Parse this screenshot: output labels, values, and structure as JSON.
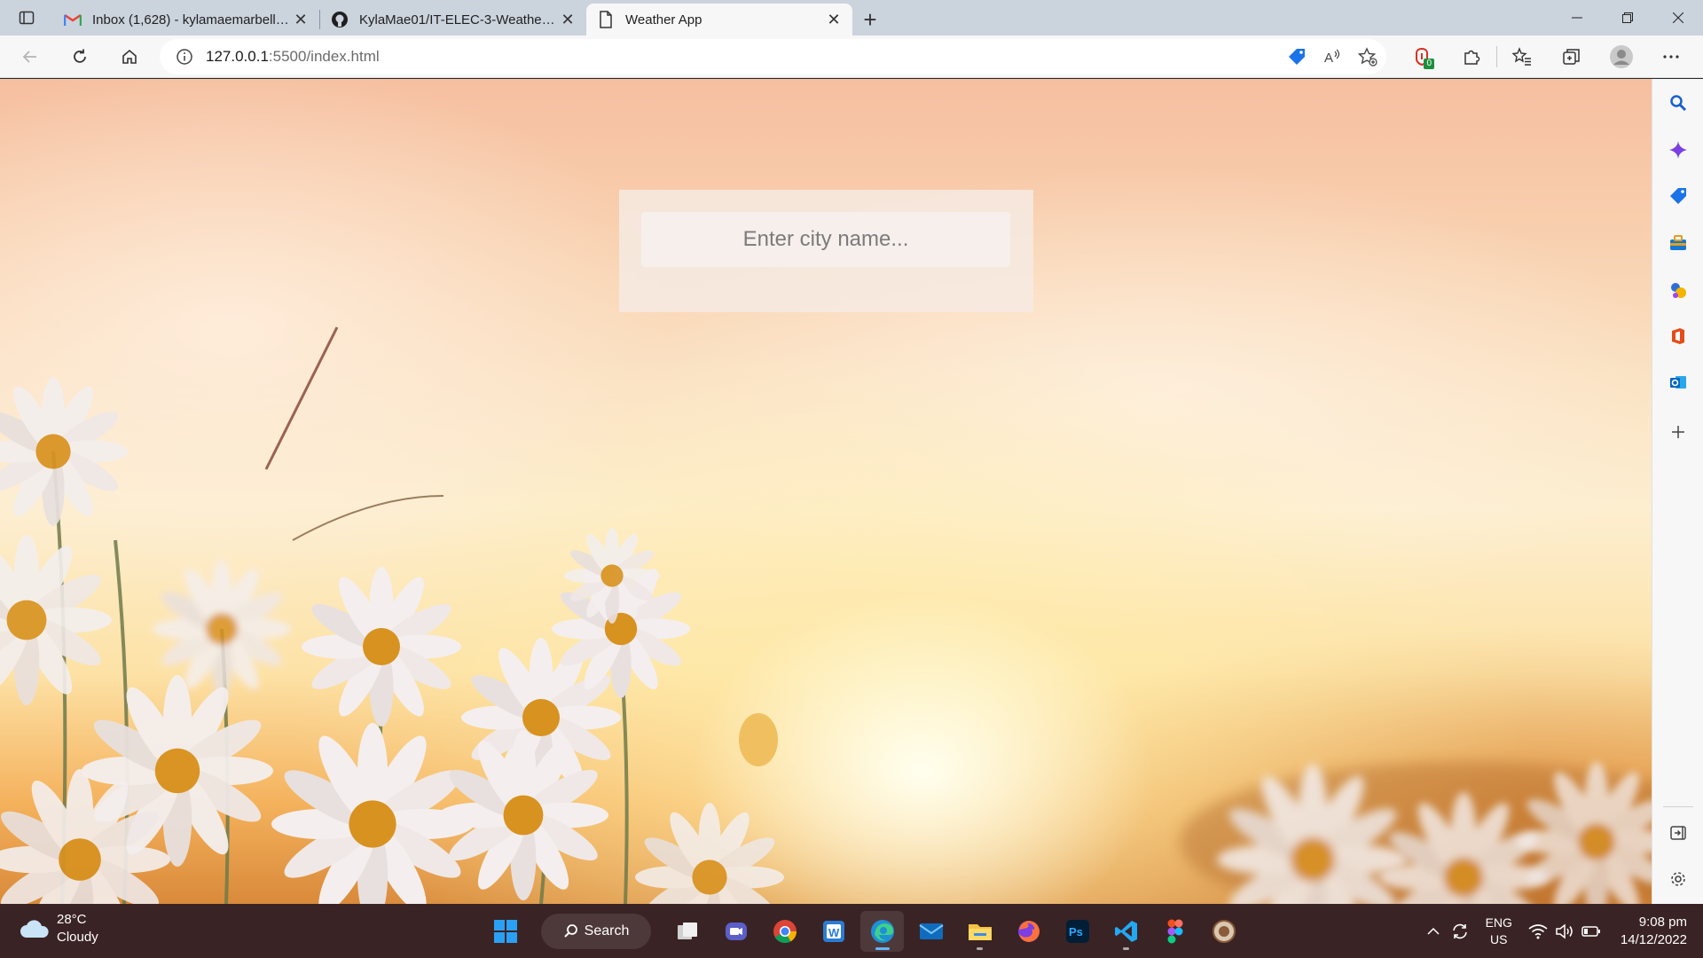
{
  "browser": {
    "tabs": [
      {
        "title": "Inbox (1,628) - kylamaemarbella@",
        "icon": "gmail-icon"
      },
      {
        "title": "KylaMae01/IT-ELEC-3-Weather-A",
        "icon": "github-icon"
      },
      {
        "title": "Weather App",
        "icon": "page-icon",
        "active": true
      }
    ],
    "address": {
      "host": "127.0.0.1",
      "path": ":5500/index.html"
    },
    "extension_badge": "0"
  },
  "page": {
    "search": {
      "placeholder": "Enter city name...",
      "value": ""
    }
  },
  "taskbar": {
    "weather": {
      "temp": "28°C",
      "condition": "Cloudy"
    },
    "search_label": "Search",
    "language": {
      "line1": "ENG",
      "line2": "US"
    },
    "clock": {
      "time": "9:08 pm",
      "date": "14/12/2022"
    }
  },
  "colors": {
    "taskbar": "#3a2324",
    "tabstrip": "#cbd3dd",
    "toolbar": "#f7f7f7",
    "card": "#f6eae2"
  }
}
